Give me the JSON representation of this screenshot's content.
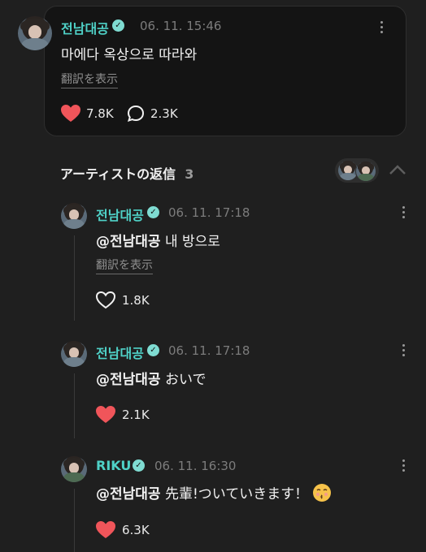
{
  "post": {
    "author": "전남대공",
    "timestamp": "06. 11. 15:46",
    "text": "마에다 옥상으로 따라와",
    "translate_label": "翻訳を表示",
    "likes": "7.8K",
    "comments": "2.3K"
  },
  "replies_section": {
    "title": "アーティストの返信",
    "count": "3"
  },
  "replies": [
    {
      "author": "전남대공",
      "timestamp": "06. 11. 17:18",
      "mention": "@전남대공",
      "text": "내 방으로",
      "translate_label": "翻訳を表示",
      "likes": "1.8K",
      "liked": false
    },
    {
      "author": "전남대공",
      "timestamp": "06. 11. 17:18",
      "mention": "@전남대공",
      "text": "おいで",
      "likes": "2.1K",
      "liked": true
    },
    {
      "author": "RIKU",
      "timestamp": "06. 11. 16:30",
      "mention": "@전남대공",
      "text": "先輩!ついていきます！",
      "emoji": "kissing-face-emoji",
      "likes": "6.3K",
      "liked": true
    }
  ],
  "colors": {
    "background": "#1f1f1f",
    "card": "#141414",
    "accent": "#4fd1c7",
    "heart": "#f0555a"
  }
}
